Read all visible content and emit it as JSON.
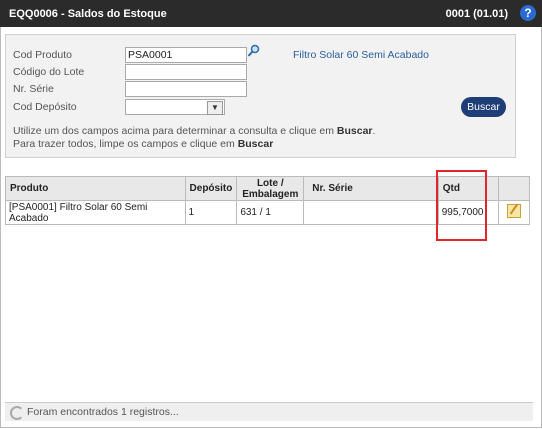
{
  "titlebar": {
    "title": "EQQ0006 - Saldos do Estoque",
    "code": "0001 (01.01)",
    "help": "?"
  },
  "form": {
    "cod_produto_label": "Cod Produto",
    "cod_produto_value": "PSA0001",
    "produto_nome": "Filtro Solar 60 Semi Acabado",
    "lote_label": "Código do Lote",
    "lote_value": "",
    "serie_label": "Nr. Série",
    "serie_value": "",
    "deposito_label": "Cod Depósito",
    "deposito_value": "",
    "buscar_label": "Buscar",
    "help_line1": "Utilize um dos campos acima para determinar a consulta e clique em ",
    "help_line1_bold": "Buscar",
    "help_line1_end": ".",
    "help_line2": "Para trazer todos, limpe os campos e clique em ",
    "help_line2_bold": "Buscar"
  },
  "table": {
    "headers": {
      "produto": "Produto",
      "deposito": "Depósito",
      "lote_1": "Lote /",
      "lote_2": "Embalagem",
      "serie": "Nr. Série",
      "qtd": "Qtd"
    },
    "rows": [
      {
        "produto": "[PSA0001] Filtro Solar 60 Semi Acabado",
        "deposito": "1",
        "lote": "631 / 1",
        "serie": "",
        "qtd": "995,7000"
      }
    ]
  },
  "status": {
    "text": "Foram encontrados 1 registros..."
  }
}
